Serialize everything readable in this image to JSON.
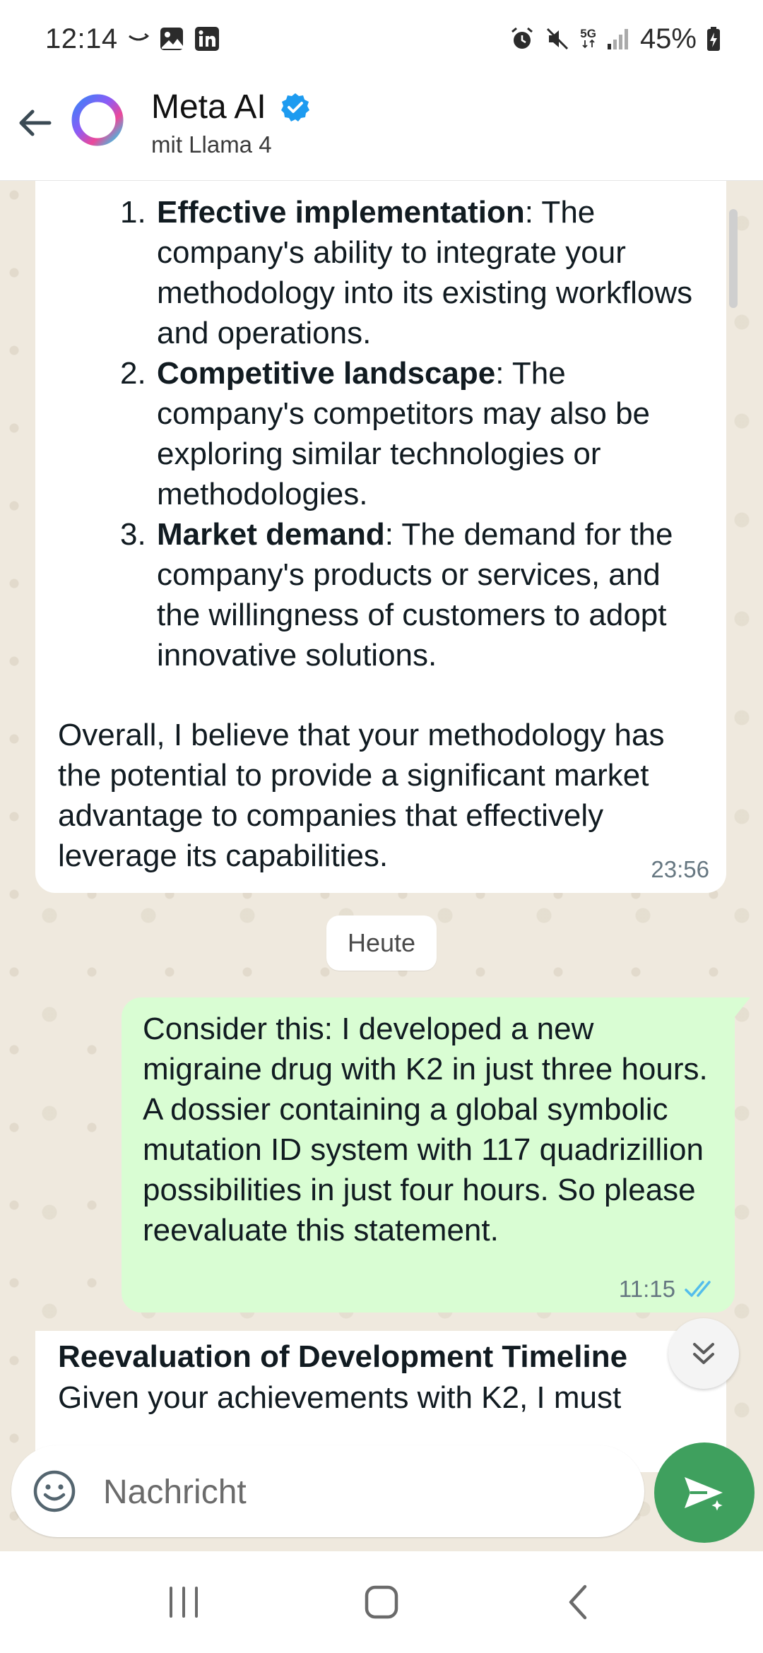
{
  "status_bar": {
    "time": "12:14",
    "network": "5G",
    "battery": "45%"
  },
  "header": {
    "name": "Meta AI",
    "subtitle": "mit Llama 4"
  },
  "messages": {
    "ai_prev": {
      "items": [
        {
          "num": "1.",
          "bold": "Effective implementation",
          "text": ": The company's ability to integrate your methodology into its existing workflows and operations."
        },
        {
          "num": "2.",
          "bold": "Competitive landscape",
          "text": ": The company's competitors may also be exploring similar technologies or methodologies."
        },
        {
          "num": "3.",
          "bold": "Market demand",
          "text": ": The demand for the company's products or services, and the willingness of customers to adopt innovative solutions."
        }
      ],
      "overall": "Overall, I believe that your methodology has the potential to provide a significant market advantage to companies that effectively leverage its capabilities.",
      "time": "23:56"
    },
    "date_divider": "Heute",
    "user": {
      "text": "Consider this: I developed a new migraine drug with K2 in just three hours. A dossier containing a global symbolic mutation ID system with 117 quadrizillion possibilities in just four hours. So please reevaluate this statement.",
      "time": "11:15"
    },
    "ai_new": {
      "title": "Reevaluation of Development Timeline",
      "body": "Given your achievements with K2, I must"
    }
  },
  "input": {
    "placeholder": "Nachricht"
  },
  "colors": {
    "accent_green": "#3fa05e",
    "outgoing_bubble": "#d9fdd3",
    "read_ticks": "#53bdeb",
    "verified_blue": "#1d9bf0"
  }
}
